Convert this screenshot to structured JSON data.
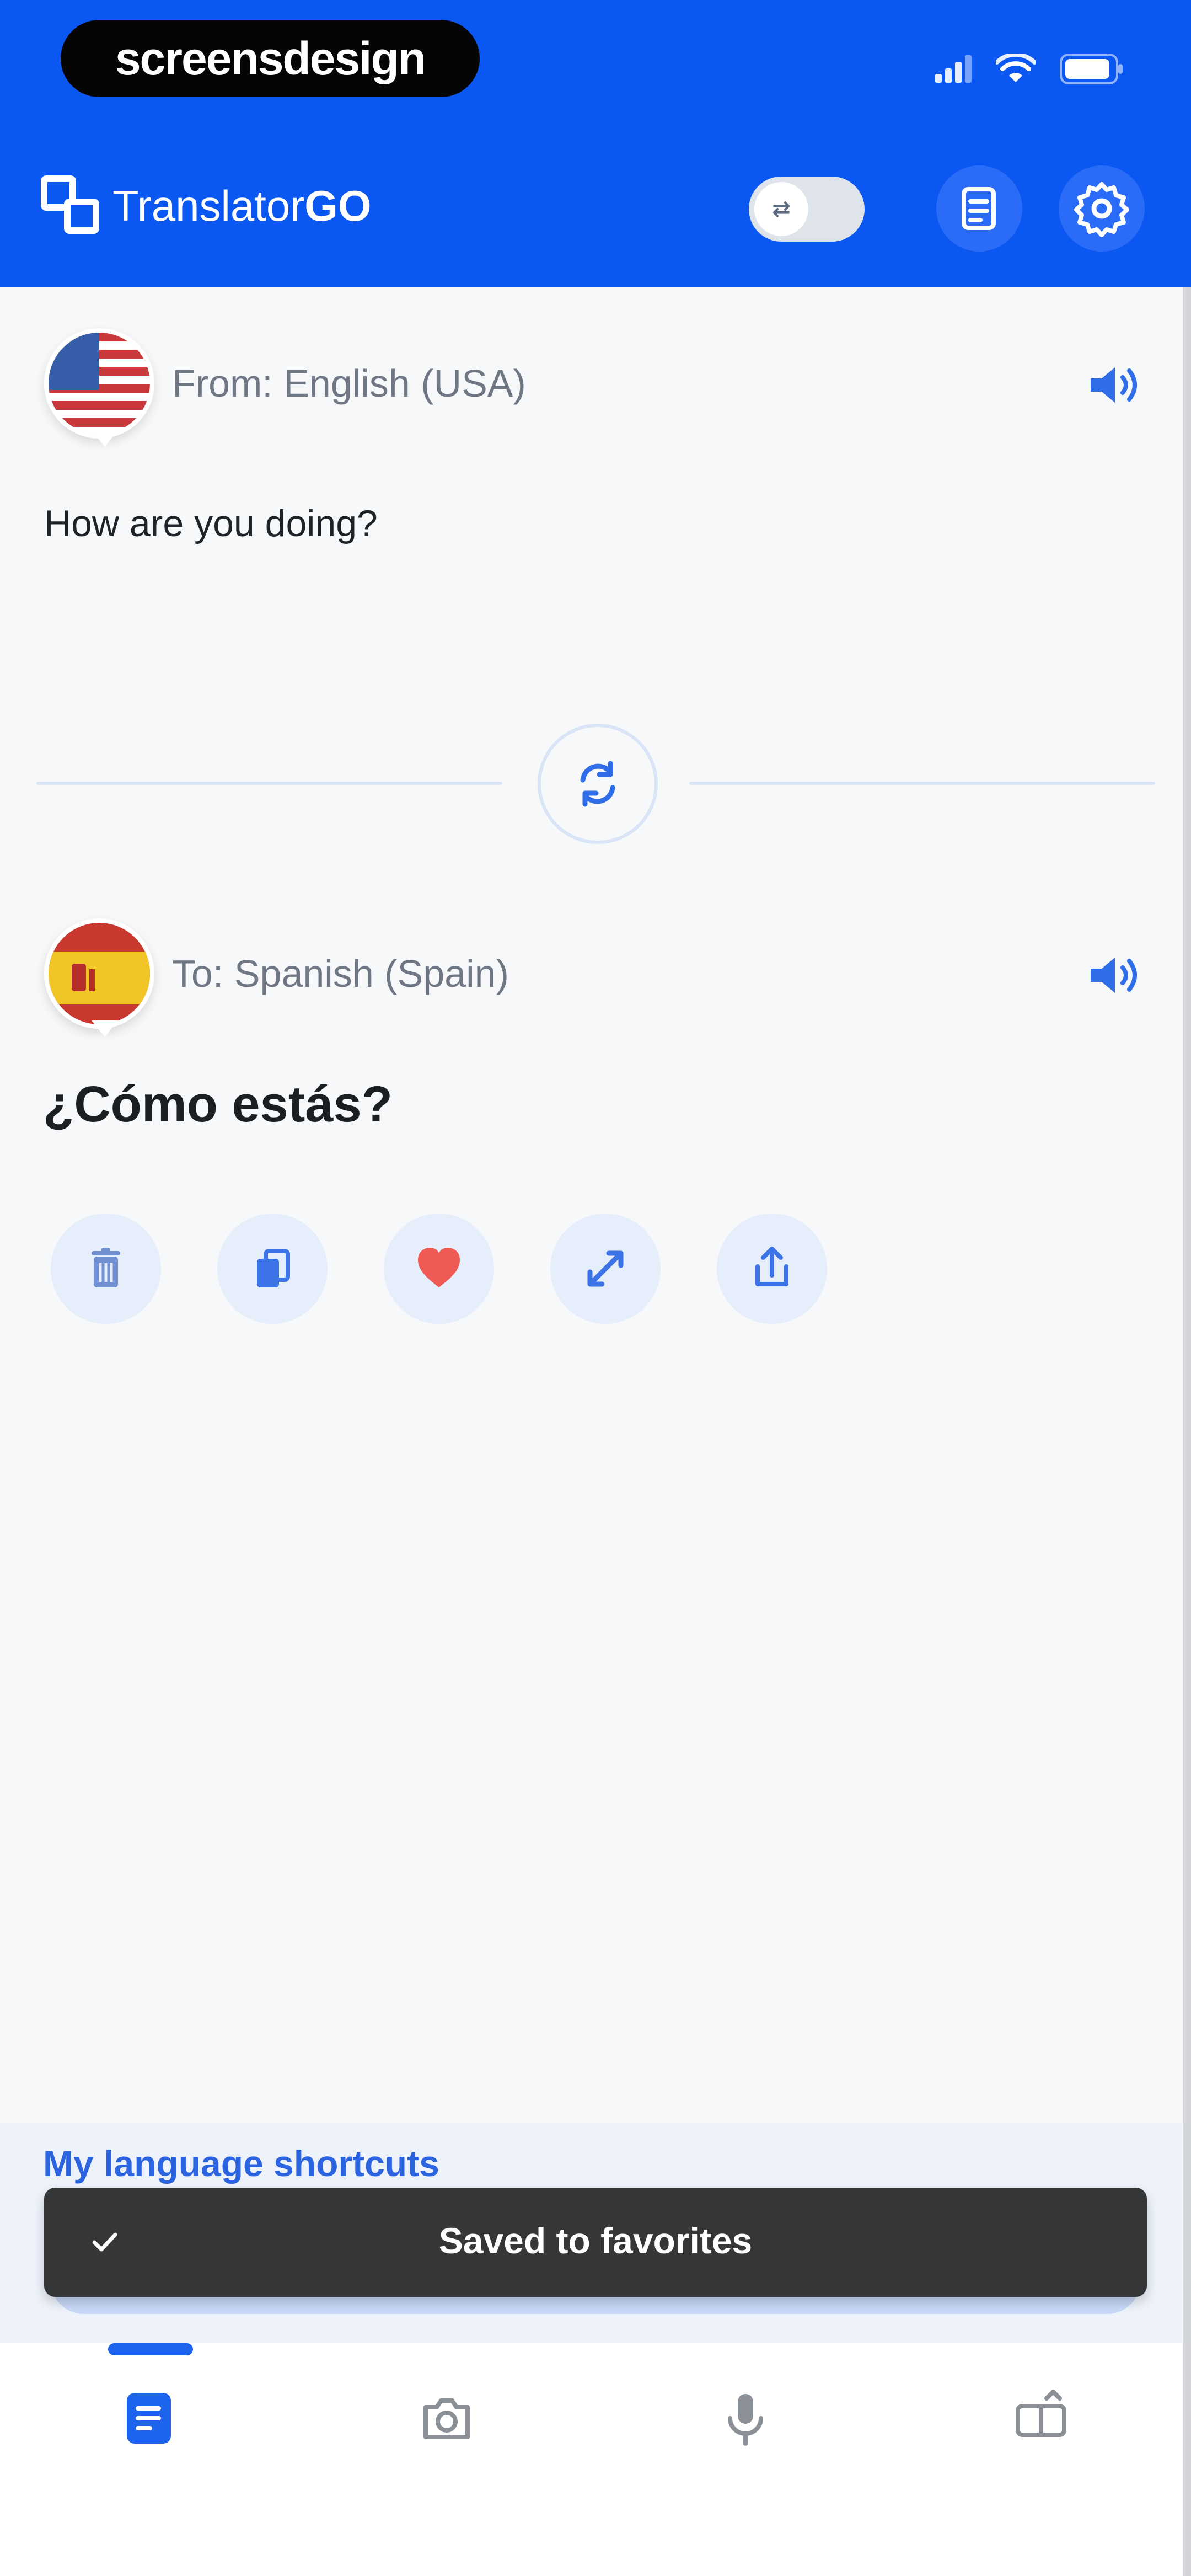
{
  "status_bar": {
    "label": "screensdesign"
  },
  "header": {
    "app_name_part1": "Translator",
    "app_name_part2": "GO",
    "toggle_label": "⇄"
  },
  "from": {
    "label": "From: English (USA)",
    "text": "How are you doing?"
  },
  "to": {
    "label": "To: Spanish (Spain)",
    "text": "¿Cómo estás?"
  },
  "shortcuts": {
    "title": "My language shortcuts"
  },
  "toast": {
    "message": "Saved to favorites"
  },
  "colors": {
    "primary": "#0b57f2",
    "accent_blue": "#2c64df",
    "toast_bg": "#343638",
    "heart_red": "#ef5a55"
  }
}
